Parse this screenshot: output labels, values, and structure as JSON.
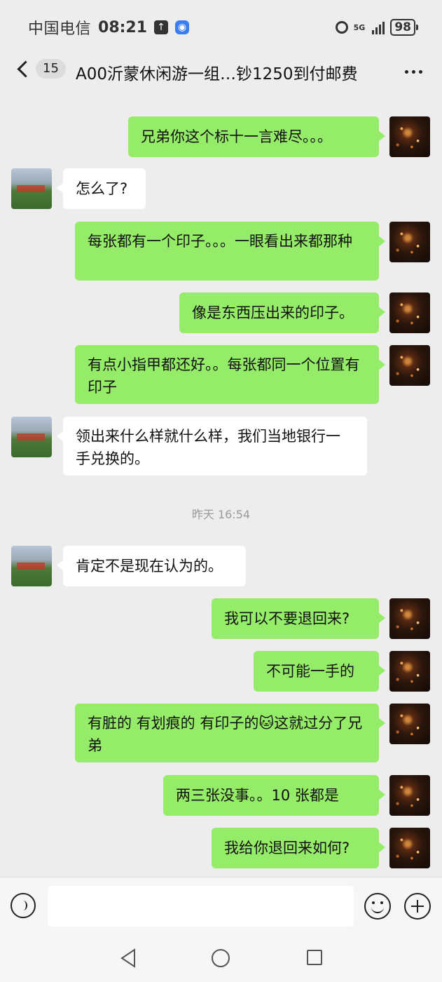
{
  "status_bar": {
    "carrier": "中国电信",
    "time": "08:21",
    "network": "5G",
    "battery": "98"
  },
  "header": {
    "unread_count": "15",
    "title": "A00沂蒙休闲游一组…钞1250到付邮费"
  },
  "messages": [
    {
      "side": "self",
      "text": "兄弟你这个标十一言难尽。。。"
    },
    {
      "side": "other",
      "text": "怎么了?"
    },
    {
      "side": "self",
      "text": "每张都有一个印子。。。一眼看出来都那种"
    },
    {
      "side": "self",
      "text": "像是东西压出来的印子。"
    },
    {
      "side": "self",
      "text": "有点小指甲都还好。。每张都同一个位置有印子"
    },
    {
      "side": "other",
      "text": "领出来什么样就什么样，我们当地银行一手兑换的。"
    },
    {
      "side": "other",
      "text": "肯定不是现在认为的。"
    },
    {
      "side": "self",
      "text": "我可以不要退回来?"
    },
    {
      "side": "self",
      "text": "不可能一手的"
    },
    {
      "side": "self",
      "text": "有脏的 有划痕的 有印子的🐱这就过分了兄弟"
    },
    {
      "side": "self",
      "text": "两三张没事。。10 张都是"
    },
    {
      "side": "self",
      "text": "我给你退回来如何?"
    }
  ],
  "timestamp": "昨天 16:54",
  "input": {
    "value": "",
    "placeholder": ""
  },
  "colors": {
    "self_bubble": "#95ec69",
    "other_bubble": "#ffffff",
    "background": "#ededed"
  }
}
